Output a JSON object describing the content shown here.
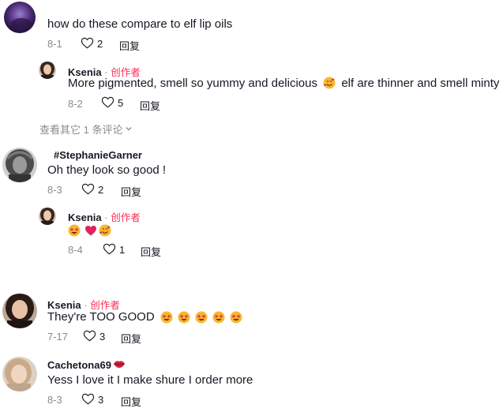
{
  "comments": [
    {
      "text": "how do these compare to elf lip oils",
      "date": "8-1",
      "likes": "2",
      "reply_label": "回复",
      "replies": [
        {
          "username": "Ksenia",
          "separator": "·",
          "badge": "创作者",
          "text": "More pigmented, smell so yummy and delicious",
          "text_after_emoji": "elf are thinner and smell minty",
          "date": "8-2",
          "likes": "5",
          "reply_label": "回复"
        }
      ],
      "view_more_label": "查看其它 1 条评论"
    },
    {
      "username": "#StephanieGarner",
      "text": "Oh they look so good !",
      "date": "8-3",
      "likes": "2",
      "reply_label": "回复",
      "replies": [
        {
          "username": "Ksenia",
          "separator": "·",
          "badge": "创作者",
          "date": "8-4",
          "likes": "1",
          "reply_label": "回复"
        }
      ]
    },
    {
      "username": "Ksenia",
      "separator": "·",
      "badge": "创作者",
      "text": "They're TOO GOOD",
      "date": "7-17",
      "likes": "3",
      "reply_label": "回复"
    },
    {
      "username": "Cachetona69",
      "text": "Yess I love it I make shure I order more",
      "date": "8-3",
      "likes": "3",
      "reply_label": "回复"
    }
  ],
  "icons": {
    "like": "heart-outline-icon",
    "chevron": "chevron-down-icon",
    "emoji_star_eyes": "star-struck-emoji",
    "emoji_hearts": "smiling-face-with-hearts-emoji",
    "emoji_red_heart": "red-heart-emoji",
    "emoji_lips": "lips-emoji"
  },
  "colors": {
    "creator_badge": "#fe2c55",
    "meta_gray": "#8a8b91",
    "text": "#161823"
  }
}
